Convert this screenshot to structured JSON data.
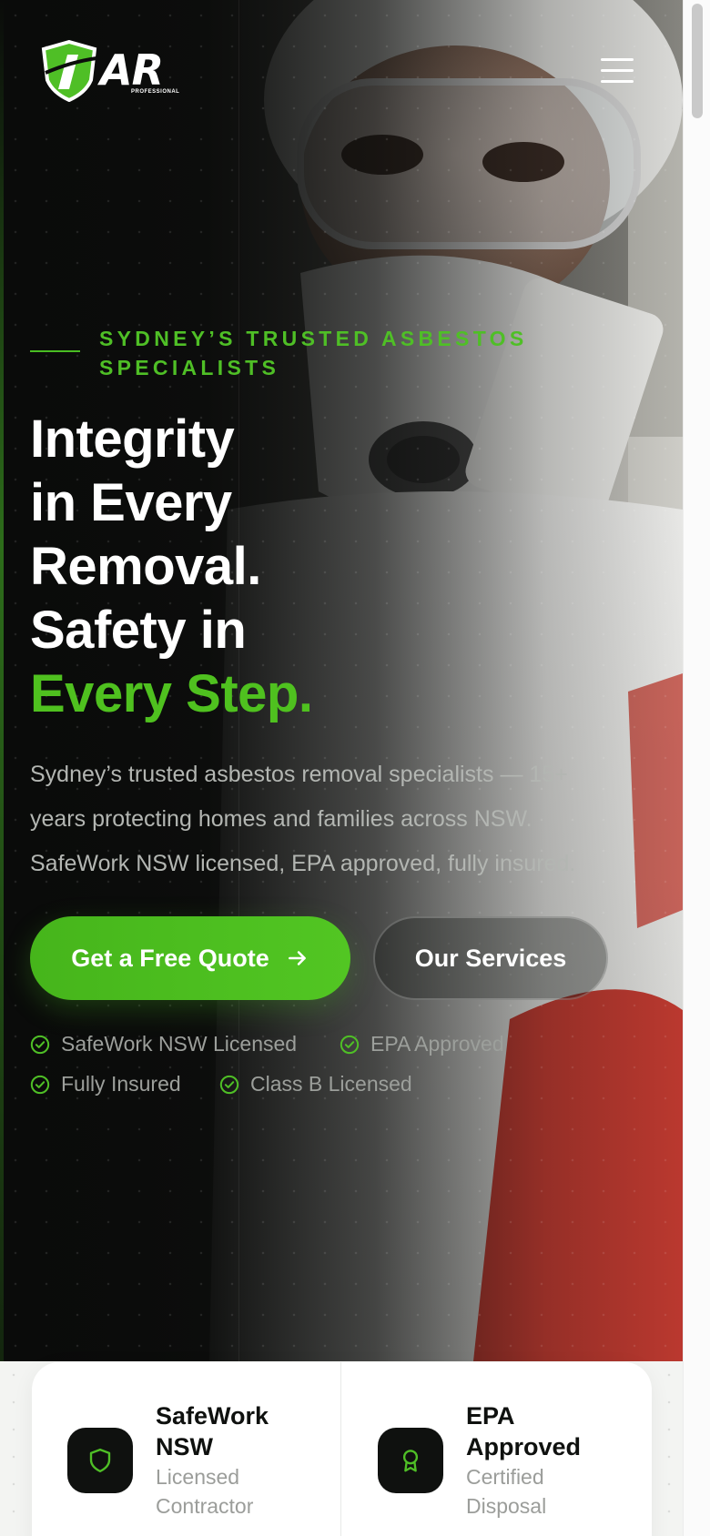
{
  "header": {
    "logo_text": "AR",
    "logo_sub": "PROFESSIONAL",
    "menu_icon": "hamburger-menu-icon"
  },
  "hero": {
    "eyebrow_line1": "SYDNEY’S TRUSTED ASBESTOS",
    "eyebrow_line2": "SPECIALISTS",
    "headline": {
      "line1": "Integrity",
      "line2": "in Every",
      "line3": "Removal.",
      "line4": "Safety in",
      "line5_accent": "Every Step."
    },
    "description_lines": [
      "Sydney’s trusted asbestos removal specialists — 15+",
      "years protecting homes and families across NSW.",
      "SafeWork NSW licensed, EPA approved, fully insured."
    ],
    "primary_cta": "Get a Free Quote",
    "secondary_cta": "Our Services",
    "badges": [
      "SafeWork NSW Licensed",
      "EPA Approved",
      "Fully Insured",
      "Class B Licensed"
    ]
  },
  "stats": [
    {
      "title_line1": "SafeWork",
      "title_line2": "NSW",
      "sub_line1": "Licensed",
      "sub_line2": "Contractor",
      "icon": "shield-icon"
    },
    {
      "title_line1": "EPA",
      "title_line2": "Approved",
      "sub_line1": "Certified",
      "sub_line2": "Disposal",
      "icon": "award-ribbon-icon"
    }
  ],
  "colors": {
    "accent": "#4fc11f",
    "dark": "#0f110f",
    "muted_text": "#9c9f9b"
  }
}
